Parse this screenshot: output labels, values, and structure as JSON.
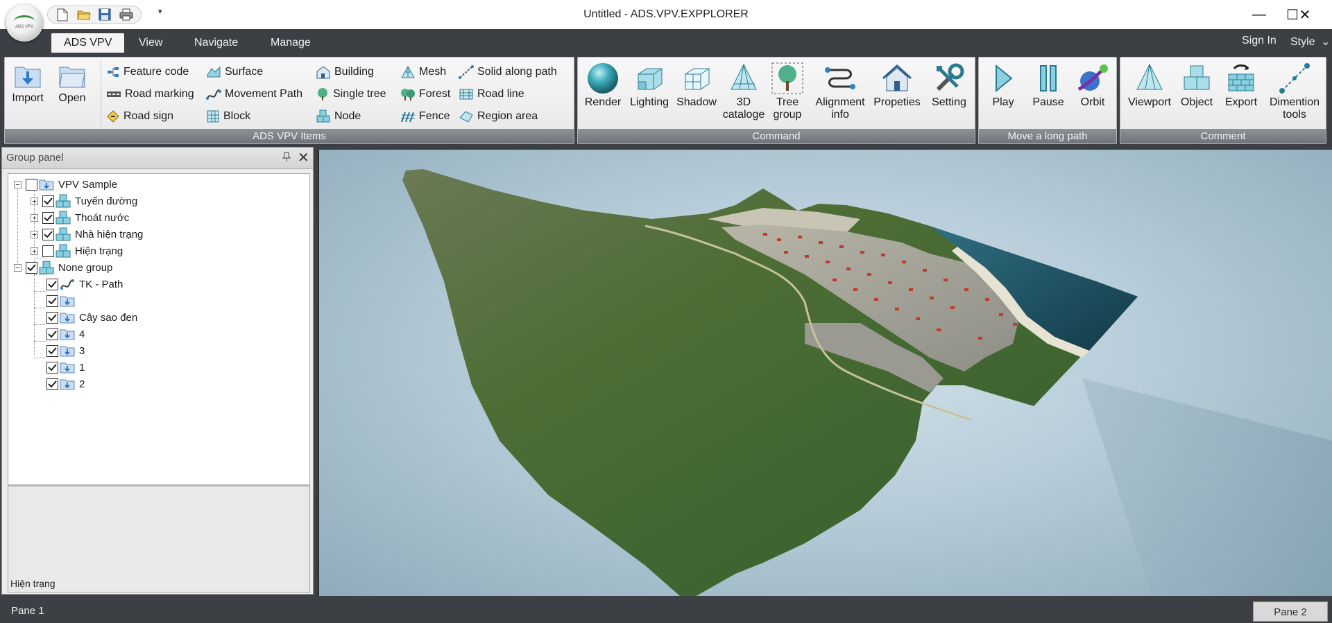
{
  "window": {
    "title": "Untitled - ADS.VPV.EXPPLORER",
    "logo_text": "ADS VPV",
    "minimize_symbol": "—",
    "maximize_symbol": "☐",
    "close_symbol": "✕"
  },
  "quick_access": {
    "buttons": [
      "new-file-icon",
      "open-folder-icon",
      "save-icon",
      "print-icon"
    ],
    "more_symbol": "▾"
  },
  "menu": {
    "tabs": [
      "ADS VPV",
      "View",
      "Navigate",
      "Manage"
    ],
    "active_tab": "ADS VPV",
    "sign_in": "Sign In",
    "style": "Style",
    "style_arrow": "⌄"
  },
  "ribbon": {
    "file_group": {
      "import": "Import",
      "open": "Open"
    },
    "items_group": {
      "label": "ADS VPV Items",
      "col1": [
        "Feature code",
        "Road marking",
        "Road sign"
      ],
      "col2": [
        "Surface",
        "Movement Path",
        "Block"
      ],
      "col3": [
        "Building",
        "Single tree",
        "Node"
      ],
      "col4": [
        "Mesh",
        "Forest",
        "Fence"
      ],
      "col5": [
        "Solid along path",
        "Road line",
        "Region area"
      ]
    },
    "command_group": {
      "label": "Command",
      "render": "Render",
      "lighting": "Lighting",
      "shadow": "Shadow",
      "catalogue_line1": "3D",
      "catalogue_line2": "cataloge",
      "tree_line1": "Tree",
      "tree_line2": "group",
      "alignment_line1": "Alignment",
      "alignment_line2": "info",
      "propeties": "Propeties",
      "setting": "Setting"
    },
    "path_group": {
      "label": "Move a long path",
      "play": "Play",
      "pause": "Pause",
      "orbit": "Orbit"
    },
    "comment_group": {
      "label": "Comment",
      "viewport": "Viewport",
      "object": "Object",
      "export": "Export",
      "dimention_line1": "Dimention",
      "dimention_line2": "tools"
    }
  },
  "group_panel": {
    "title": "Group panel",
    "pin_symbol": "📌",
    "close_symbol": "✕",
    "tree": {
      "root1": {
        "label": "VPV Sample",
        "checked": false,
        "expanded": true
      },
      "root1_children": [
        {
          "label": "Tuyến đường",
          "checked": true
        },
        {
          "label": "Thoát nước",
          "checked": true
        },
        {
          "label": "Nhà hiện trạng",
          "checked": true
        },
        {
          "label": "Hiện trạng",
          "checked": false
        }
      ],
      "root2": {
        "label": "None group",
        "checked": true,
        "expanded": true
      },
      "root2_children": [
        {
          "label": "TK - Path",
          "checked": true
        },
        {
          "label": "",
          "checked": true
        },
        {
          "label": "Cây sao đen",
          "checked": true
        },
        {
          "label": "4",
          "checked": true
        },
        {
          "label": "3",
          "checked": true
        },
        {
          "label": "1",
          "checked": true
        },
        {
          "label": "2",
          "checked": true
        }
      ]
    },
    "selected_info": "Hiện trạng"
  },
  "status": {
    "pane1": "Pane 1",
    "pane2": "Pane 2"
  },
  "colors": {
    "chrome_dark": "#3c3f43",
    "ribbon_bg": "#efefef",
    "accent_teal": "#3aa8b8",
    "terrain_green": "#3f6a2c",
    "sea_blue": "#1f5568"
  }
}
